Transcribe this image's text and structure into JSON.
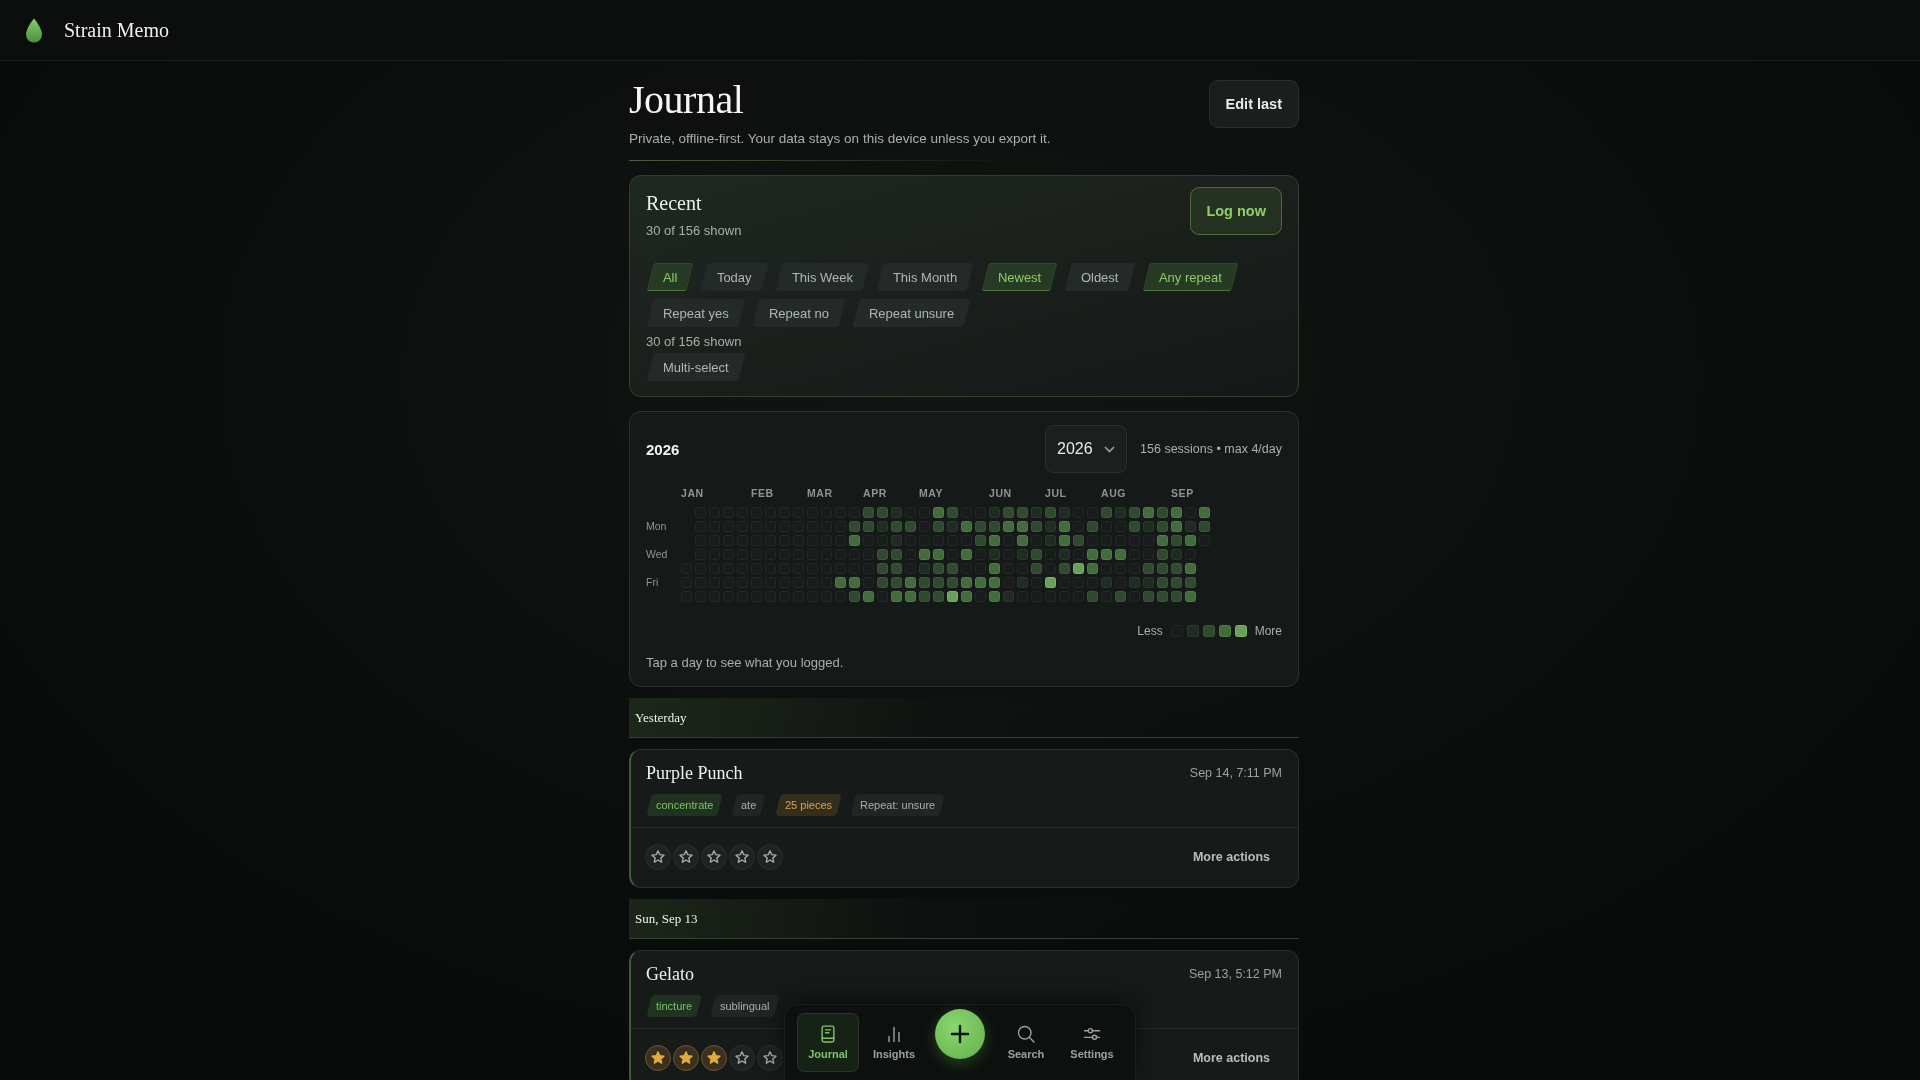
{
  "app": {
    "title": "Strain Memo"
  },
  "page": {
    "title": "Journal",
    "subtitle": "Private, offline-first. Your data stays on this device unless you export it.",
    "edit_button": "Edit last"
  },
  "recent": {
    "title": "Recent",
    "count": "30 of 156 shown",
    "log_button": "Log now",
    "filters": [
      {
        "label": "All",
        "selected": true
      },
      {
        "label": "Today",
        "selected": false
      },
      {
        "label": "This Week",
        "selected": false
      },
      {
        "label": "This Month",
        "selected": false
      },
      {
        "label": "Newest",
        "selected": true
      },
      {
        "label": "Oldest",
        "selected": false
      },
      {
        "label": "Any repeat",
        "selected": true
      },
      {
        "label": "Repeat yes",
        "selected": false
      },
      {
        "label": "Repeat no",
        "selected": false
      },
      {
        "label": "Repeat unsure",
        "selected": false
      }
    ],
    "count_below": "30 of 156 shown",
    "multi_select": {
      "label": "Multi-select",
      "selected": false
    }
  },
  "calendar": {
    "title": "2026",
    "year_select": {
      "value": "2026"
    },
    "summary": "156 sessions • max 4/day",
    "months": [
      "JAN",
      "FEB",
      "MAR",
      "APR",
      "MAY",
      "JUN",
      "JUL",
      "AUG",
      "SEP"
    ],
    "weekdays": [
      "Mon",
      "Wed",
      "Fri"
    ],
    "legend": {
      "less": "Less",
      "more": "More"
    },
    "hint": "Tap a day to see what you logged."
  },
  "days": [
    {
      "label": "Yesterday",
      "entries": [
        {
          "name": "Purple Punch",
          "time": "Sep 14, 7:11 PM",
          "tags": [
            {
              "kind": "form",
              "text": "concentrate"
            },
            {
              "kind": "method",
              "text": "ate"
            },
            {
              "kind": "amount",
              "text": "25 pieces"
            },
            {
              "kind": "repeat",
              "text": "Repeat: unsure"
            }
          ],
          "stars": 0,
          "actions_button": "More actions"
        }
      ]
    },
    {
      "label": "Sun, Sep 13",
      "entries": [
        {
          "name": "Gelato",
          "time": "Sep 13, 5:12 PM",
          "tags": [
            {
              "kind": "form",
              "text": "tincture"
            },
            {
              "kind": "method",
              "text": "sublingual"
            }
          ],
          "stars": 3,
          "actions_button": "More actions"
        }
      ]
    }
  ],
  "nav": {
    "tabs": [
      {
        "label": "Journal",
        "selected": true
      },
      {
        "label": "Insights",
        "selected": false
      },
      {
        "label": "Search",
        "selected": false
      },
      {
        "label": "Settings",
        "selected": false
      }
    ]
  }
}
